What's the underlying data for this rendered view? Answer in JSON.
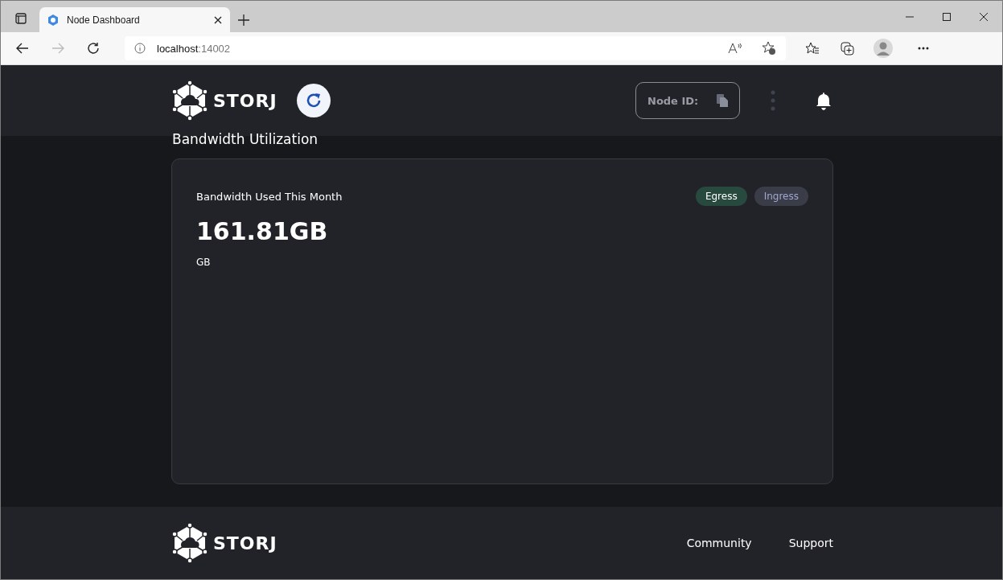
{
  "browser": {
    "tab_title": "Node Dashboard",
    "address_host": "localhost",
    "address_port": ":14002"
  },
  "header": {
    "logo_text": "STORJ",
    "node_id_label": "Node ID:"
  },
  "section_title": "Bandwidth Utilization",
  "card": {
    "title": "Bandwidth Used This Month",
    "value": "161.81GB",
    "unit": "GB",
    "toggles": [
      {
        "label": "Egress",
        "selected": true
      },
      {
        "label": "Ingress",
        "selected": false
      }
    ]
  },
  "footer": {
    "logo_text": "STORJ",
    "links": [
      "Community",
      "Support"
    ]
  }
}
